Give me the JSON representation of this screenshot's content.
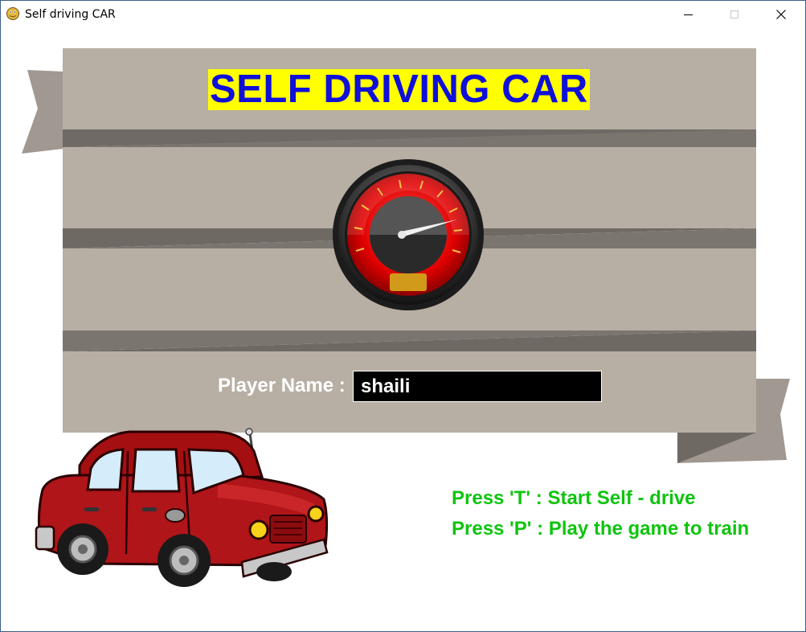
{
  "window": {
    "title": "Self driving CAR",
    "icon": "pygame-snake-icon",
    "controls": [
      "minimize-icon",
      "maximize-icon",
      "close-icon"
    ]
  },
  "game": {
    "title": "SELF DRIVING CAR",
    "title_color": "#1010d8",
    "title_bg": "#ffff00",
    "banner_color": "#b8afa4",
    "player_label": "Player Name :",
    "player_name": "shaili",
    "instructions": {
      "start": "Press 'T' : Start Self - drive",
      "play": "Press 'P' : Play the game to train"
    },
    "instruction_color": "#0fc40f"
  }
}
